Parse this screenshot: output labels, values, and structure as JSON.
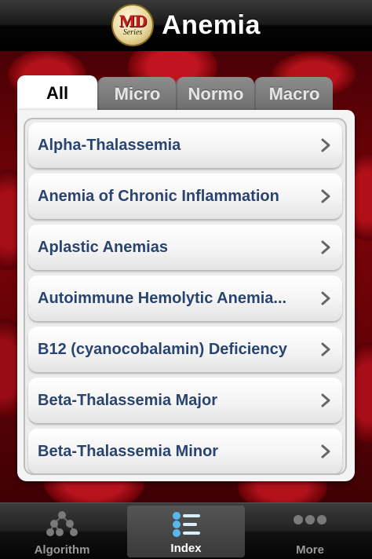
{
  "navbar": {
    "logo_text": "MD",
    "logo_sub": "Series",
    "title": "Anemia"
  },
  "tabs": [
    {
      "label": "All",
      "active": true
    },
    {
      "label": "Micro",
      "active": false
    },
    {
      "label": "Normo",
      "active": false
    },
    {
      "label": "Macro",
      "active": false
    }
  ],
  "list": {
    "items": [
      {
        "label": "Alpha-Thalassemia"
      },
      {
        "label": "Anemia of Chronic Inflammation"
      },
      {
        "label": "Aplastic Anemias"
      },
      {
        "label": "Autoimmune Hemolytic Anemia..."
      },
      {
        "label": "B12 (cyanocobalamin) Deficiency"
      },
      {
        "label": "Beta-Thalassemia Major"
      },
      {
        "label": "Beta-Thalassemia Minor"
      }
    ],
    "row_icon": "chevron-right-icon"
  },
  "tabbar": {
    "items": [
      {
        "label": "Algorithm",
        "icon": "algorithm-tree-icon",
        "selected": false
      },
      {
        "label": "Index",
        "icon": "list-index-icon",
        "selected": true
      },
      {
        "label": "More",
        "icon": "more-dots-icon",
        "selected": false
      }
    ]
  },
  "colors": {
    "row_text": "#2a4470",
    "accent_index_icon": "#58b8ee"
  }
}
